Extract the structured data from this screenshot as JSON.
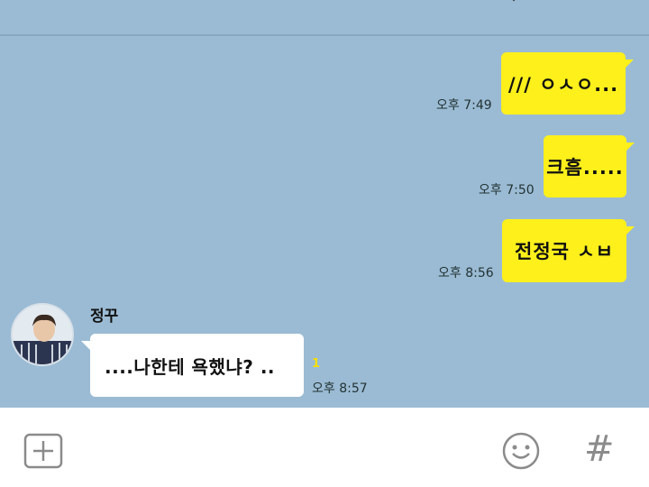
{
  "chat": {
    "sent": [
      {
        "text": "/// ㅇㅅㅇ...",
        "time": "오후 7:49"
      },
      {
        "text": "크흠.....",
        "time": "오후 7:50"
      },
      {
        "text": "전정국 ㅅㅂ",
        "time": "오후 8:56"
      }
    ],
    "received": {
      "sender": "정꾸",
      "text": "....나한테 욕했냐?  ..",
      "unread": "1",
      "time": "오후 8:57"
    }
  },
  "input_bar": {
    "add_icon": "plus-square-icon",
    "emoji_icon": "smile-icon",
    "hash_label": "#"
  },
  "colors": {
    "background": "#9bbbd4",
    "sent_bubble": "#fef01b",
    "received_bubble": "#ffffff",
    "unread": "#f6e000",
    "icon_gray": "#8b8b8b"
  }
}
